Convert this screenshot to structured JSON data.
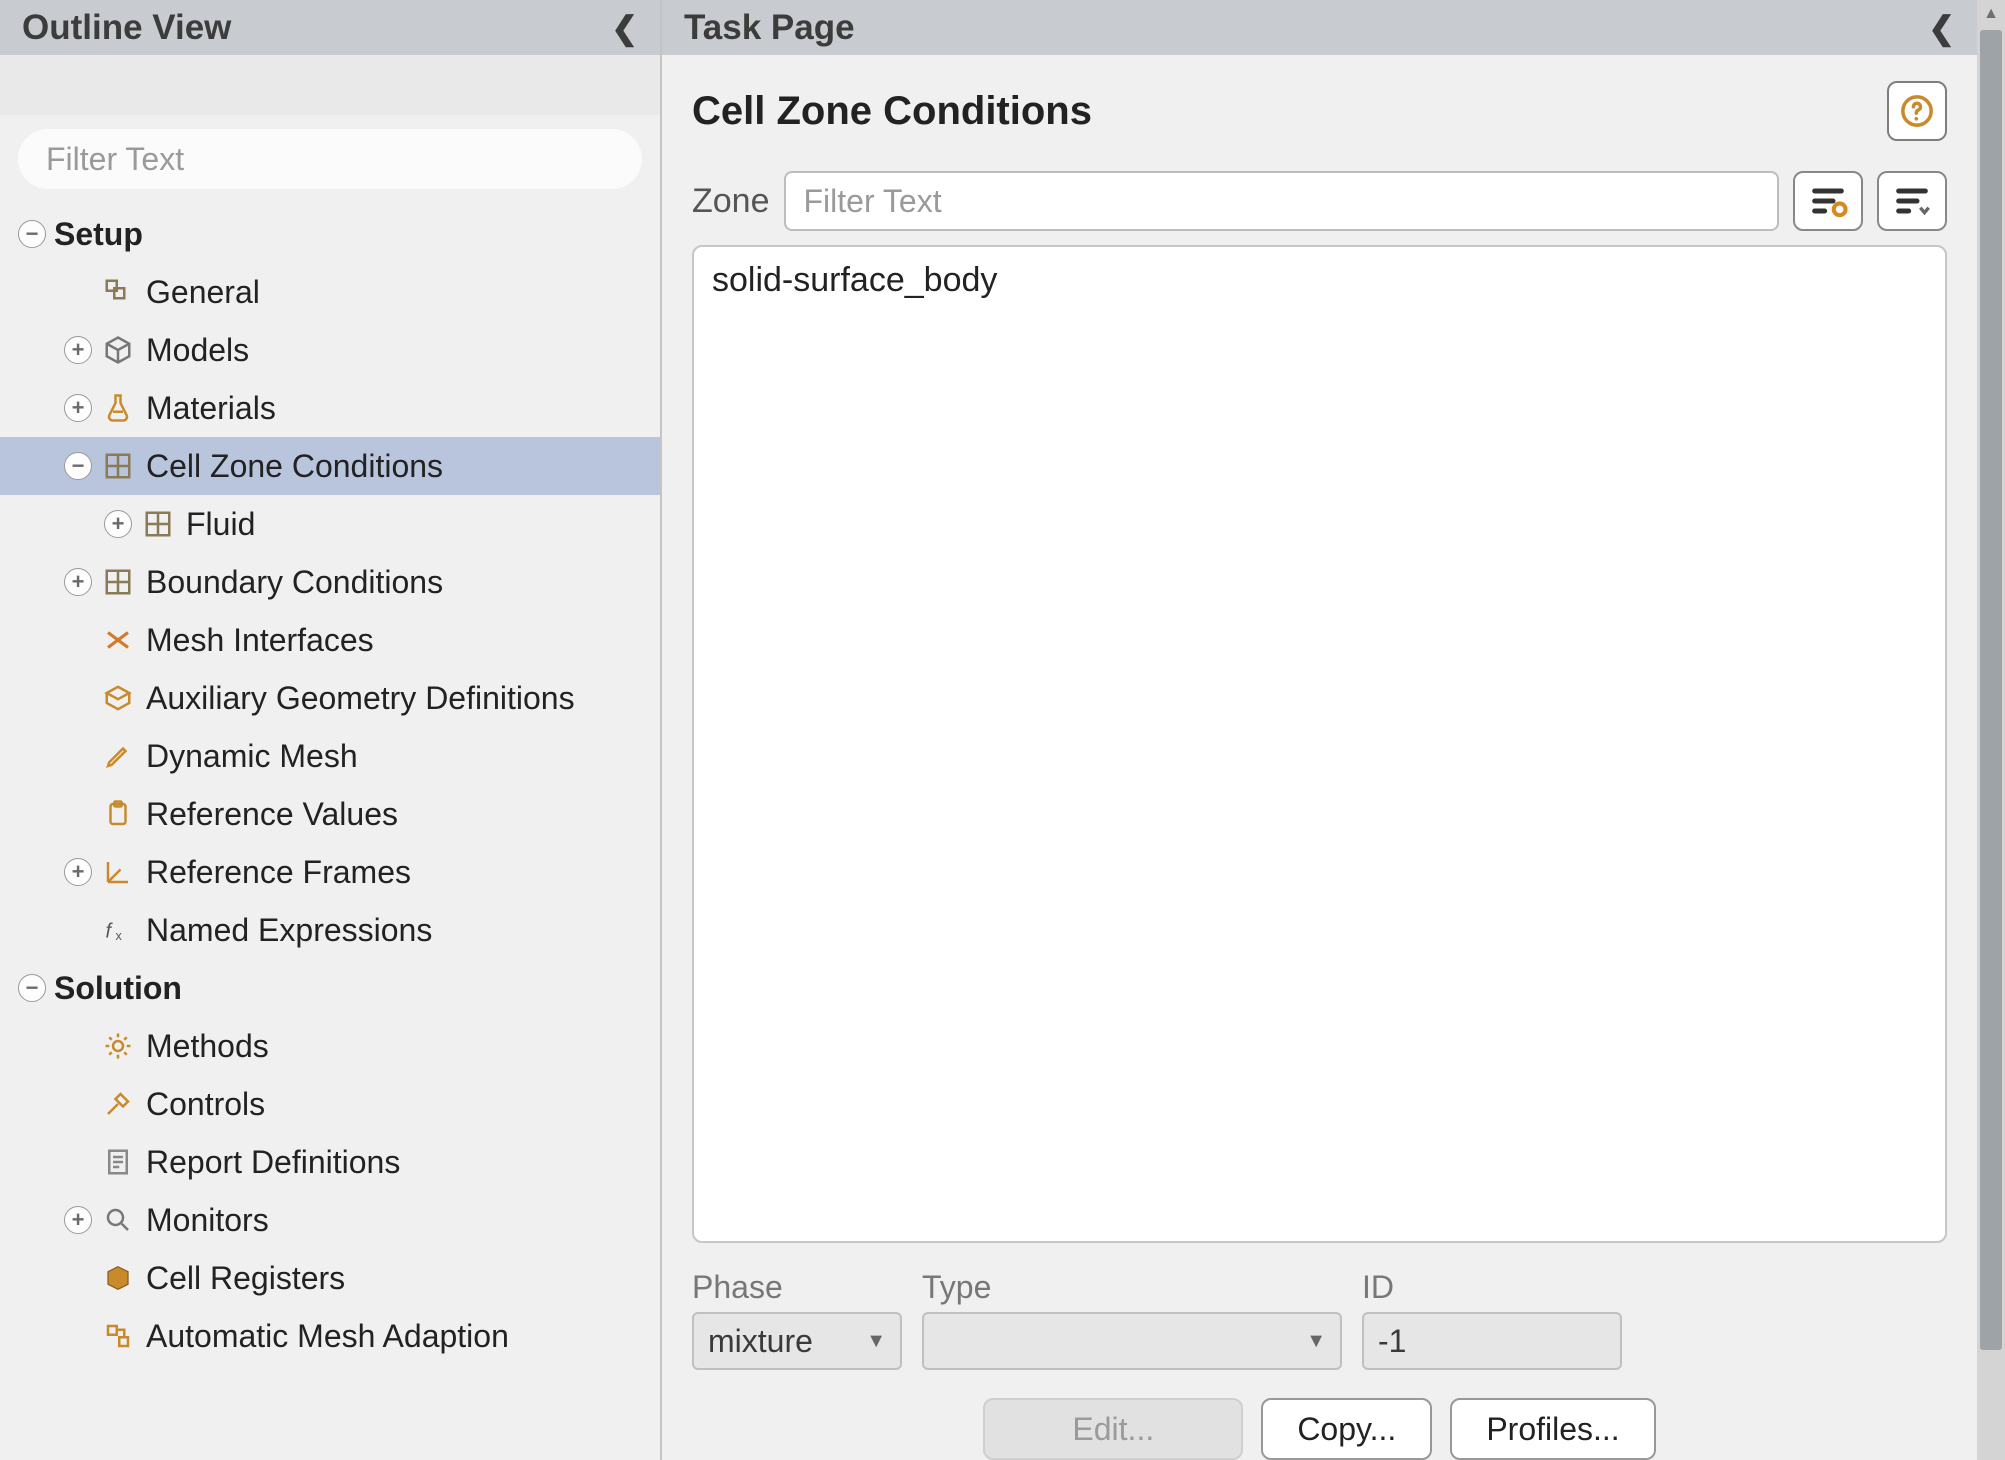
{
  "outline": {
    "title": "Outline View",
    "filter_placeholder": "Filter Text",
    "sections": {
      "setup": "Setup",
      "solution": "Solution"
    },
    "items": {
      "general": "General",
      "models": "Models",
      "materials": "Materials",
      "cell_zone": "Cell Zone Conditions",
      "fluid": "Fluid",
      "boundary": "Boundary Conditions",
      "mesh_if": "Mesh Interfaces",
      "aux_geom": "Auxiliary Geometry Definitions",
      "dyn_mesh": "Dynamic Mesh",
      "ref_vals": "Reference Values",
      "ref_frames": "Reference Frames",
      "named_expr": "Named Expressions",
      "methods": "Methods",
      "controls": "Controls",
      "report_defs": "Report Definitions",
      "monitors": "Monitors",
      "cell_regs": "Cell Registers",
      "auto_mesh": "Automatic Mesh Adaption"
    }
  },
  "task": {
    "title": "Task Page",
    "page_title": "Cell Zone Conditions",
    "zone_label": "Zone",
    "zone_filter_placeholder": "Filter Text",
    "zone_items": [
      "solid-surface_body"
    ],
    "phase_label": "Phase",
    "phase_value": "mixture",
    "type_label": "Type",
    "type_value": "",
    "id_label": "ID",
    "id_value": "-1",
    "buttons": {
      "edit": "Edit...",
      "copy": "Copy...",
      "profiles": "Profiles..."
    }
  }
}
